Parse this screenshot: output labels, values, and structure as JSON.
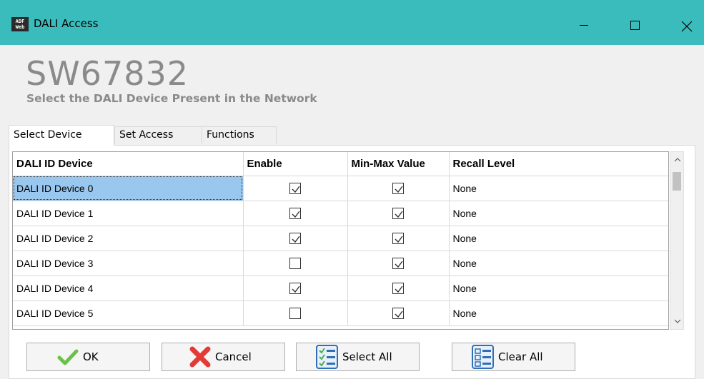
{
  "window": {
    "title": "DALI Access",
    "icon_text": "ADF\nWeb",
    "icon": "adfweb-logo-icon",
    "controls": [
      "minimize-icon",
      "maximize-icon",
      "close-icon"
    ]
  },
  "header": {
    "product_code": "SW67832",
    "subtitle": "Select the DALI Device Present in the  Network"
  },
  "tabs": [
    {
      "label": "Select Device",
      "active": true
    },
    {
      "label": "Set Access",
      "active": false
    },
    {
      "label": "Functions",
      "active": false
    }
  ],
  "table": {
    "columns": [
      "DALI ID Device",
      "Enable",
      "Min-Max Value",
      "Recall Level"
    ],
    "rows": [
      {
        "name": "DALI ID Device 0",
        "enable": true,
        "minmax": true,
        "recall": "None",
        "selected": true
      },
      {
        "name": "DALI ID Device 1",
        "enable": true,
        "minmax": true,
        "recall": "None",
        "selected": false
      },
      {
        "name": "DALI ID Device 2",
        "enable": true,
        "minmax": true,
        "recall": "None",
        "selected": false
      },
      {
        "name": "DALI ID Device 3",
        "enable": false,
        "minmax": true,
        "recall": "None",
        "selected": false
      },
      {
        "name": "DALI ID Device 4",
        "enable": true,
        "minmax": true,
        "recall": "None",
        "selected": false
      },
      {
        "name": "DALI ID Device 5",
        "enable": false,
        "minmax": true,
        "recall": "None",
        "selected": false
      }
    ]
  },
  "buttons": {
    "ok": "OK",
    "cancel": "Cancel",
    "select_all": "Select All",
    "clear_all": "Clear All"
  },
  "colors": {
    "titlebar": "#3bbcbc",
    "selection": "#99c7ee",
    "header_text": "#8a8a8a",
    "ok_check": "#6cc04a",
    "cancel_x": "#e53935",
    "list_icon": "#2f6fb5"
  }
}
